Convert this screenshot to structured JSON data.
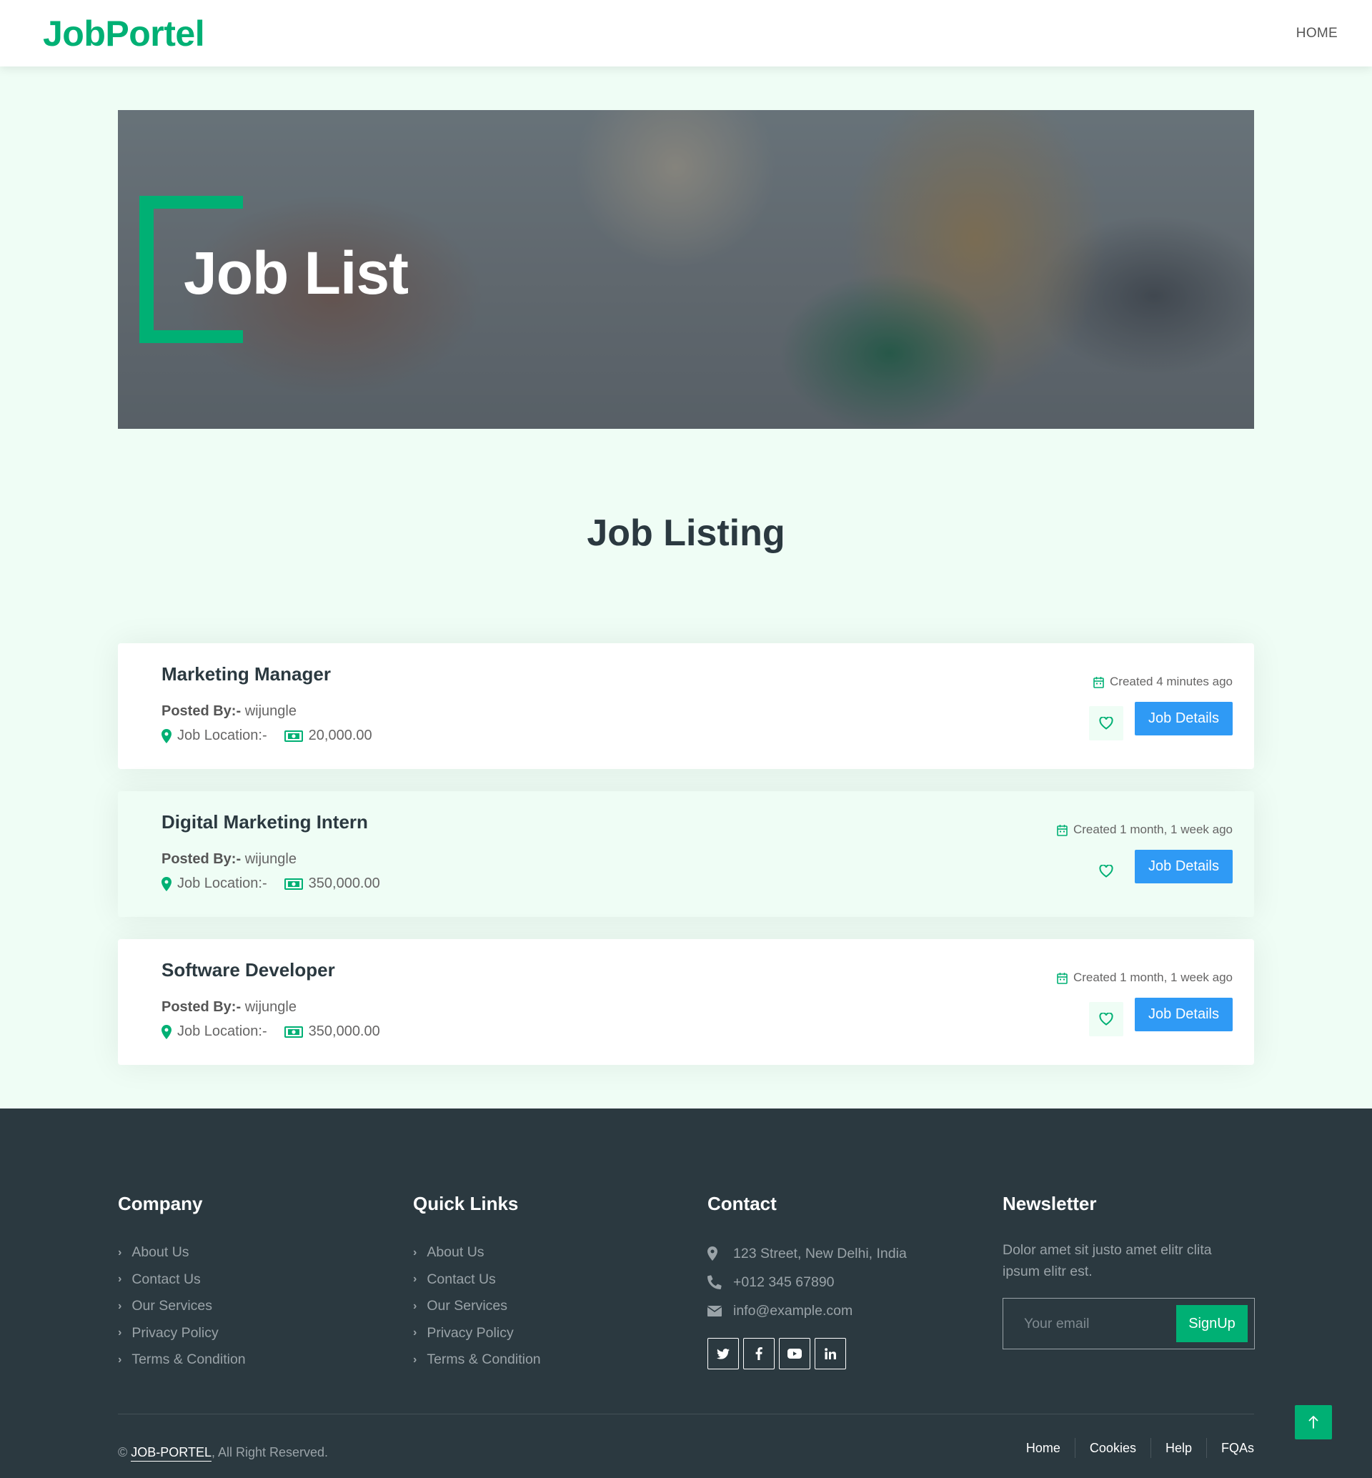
{
  "nav": {
    "brand": "JobPortel",
    "home_label": "HOME"
  },
  "hero": {
    "title": "Job List"
  },
  "listing": {
    "title": "Job Listing",
    "jobs": [
      {
        "title": "Marketing Manager",
        "posted_label": "Posted By:-",
        "posted_by": "wijungle",
        "location_label": "Job Location:-",
        "salary": "20,000.00",
        "created": "Created 4 minutes ago",
        "details_label": "Job Details"
      },
      {
        "title": "Digital Marketing Intern",
        "posted_label": "Posted By:-",
        "posted_by": "wijungle",
        "location_label": "Job Location:-",
        "salary": "350,000.00",
        "created": "Created 1 month, 1 week ago",
        "details_label": "Job Details"
      },
      {
        "title": "Software Developer",
        "posted_label": "Posted By:-",
        "posted_by": "wijungle",
        "location_label": "Job Location:-",
        "salary": "350,000.00",
        "created": "Created 1 month, 1 week ago",
        "details_label": "Job Details"
      }
    ]
  },
  "footer": {
    "company": {
      "title": "Company",
      "links": [
        "About Us",
        "Contact Us",
        "Our Services",
        "Privacy Policy",
        "Terms & Condition"
      ]
    },
    "quick_links": {
      "title": "Quick Links",
      "links": [
        "About Us",
        "Contact Us",
        "Our Services",
        "Privacy Policy",
        "Terms & Condition"
      ]
    },
    "contact": {
      "title": "Contact",
      "address": "123 Street, New Delhi, India",
      "phone": "+012 345 67890",
      "email": "info@example.com",
      "socials": [
        "twitter-icon",
        "facebook-icon",
        "youtube-icon",
        "linkedin-icon"
      ]
    },
    "newsletter": {
      "title": "Newsletter",
      "text": "Dolor amet sit justo amet elitr clita ipsum elitr est.",
      "placeholder": "Your email",
      "button": "SignUp"
    },
    "copyright_prefix": "©",
    "copyright_brand": "JOB-PORTEL",
    "copyright_suffix": ", All Right Reserved.",
    "menu": [
      "Home",
      "Cookies",
      "Help",
      "FQAs"
    ]
  },
  "colors": {
    "primary": "#00B074",
    "dark": "#2B3940",
    "light": "#EFFDF5",
    "button_blue": "#2F9AF5"
  }
}
